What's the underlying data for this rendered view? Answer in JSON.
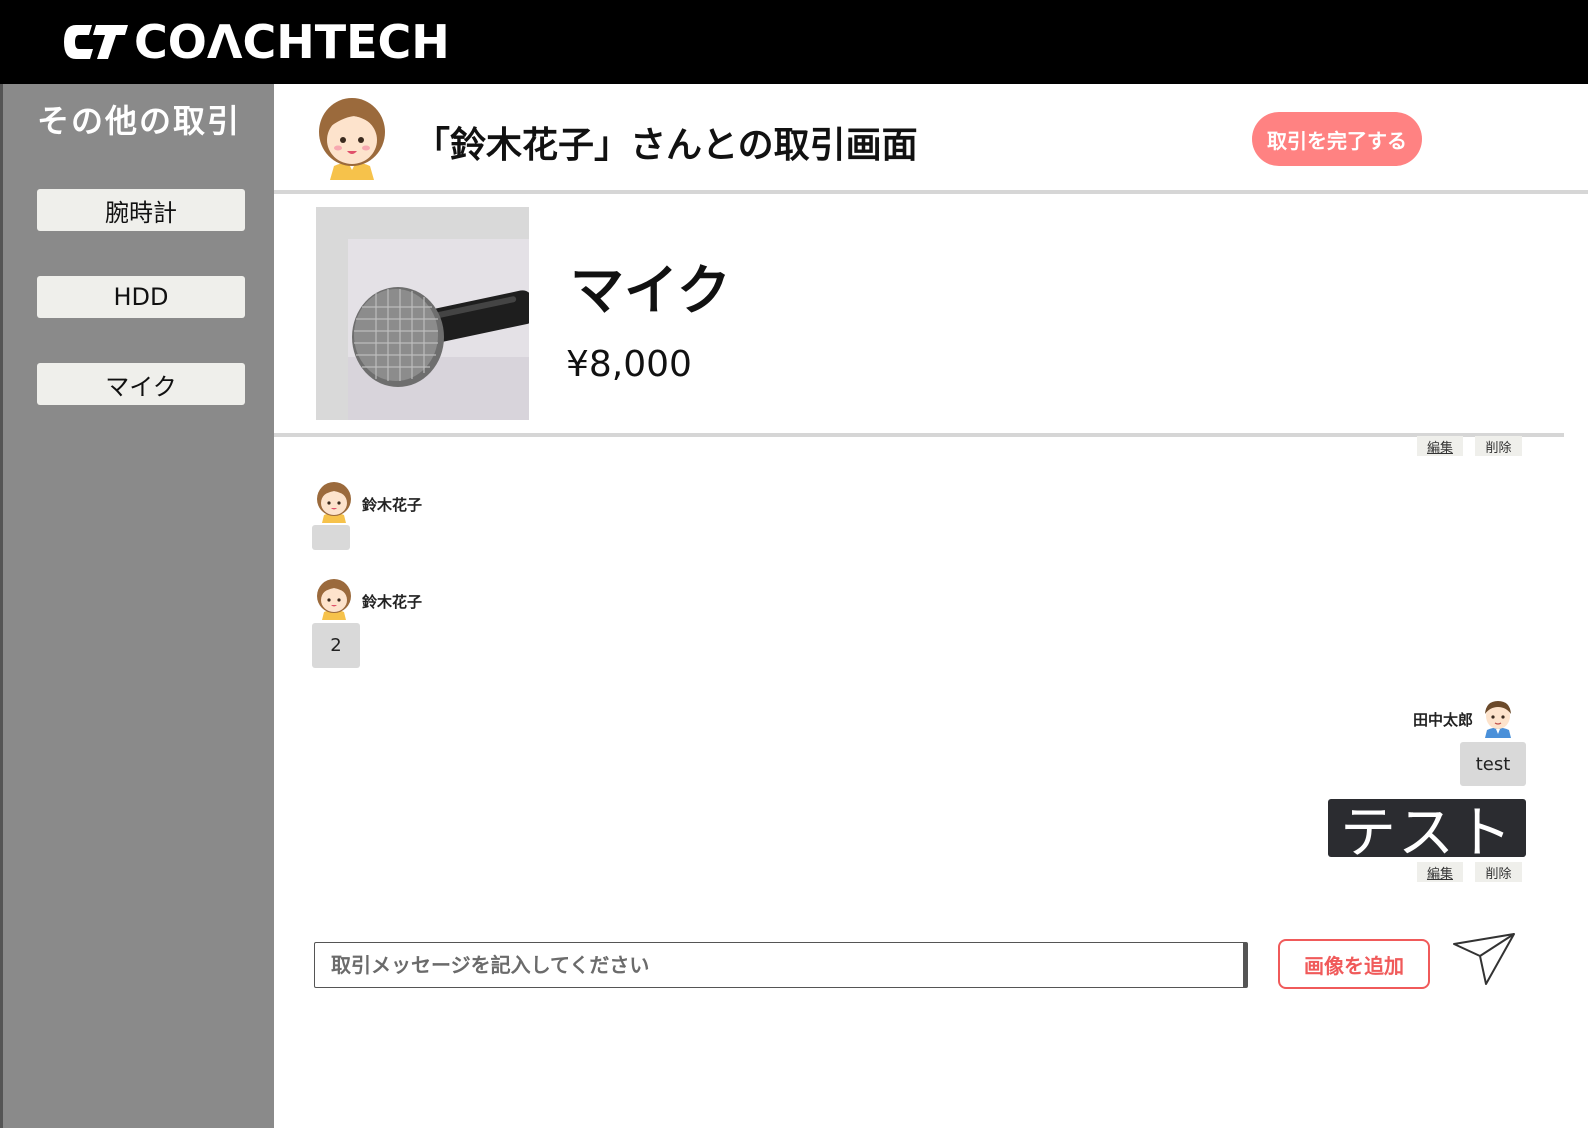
{
  "header": {
    "logo_text": "COΛCHTECH"
  },
  "sidebar": {
    "title": "その他の取引",
    "items": [
      {
        "label": "腕時計"
      },
      {
        "label": "HDD"
      },
      {
        "label": "マイク"
      }
    ]
  },
  "main": {
    "title": "「鈴木花子」さんとの取引画面",
    "complete_button": "取引を完了する"
  },
  "product": {
    "name": "マイク",
    "price": "¥8,000"
  },
  "chat": {
    "edit_label": "編集",
    "delete_label": "削除",
    "messages": [
      {
        "sender": "鈴木花子",
        "text": ""
      },
      {
        "sender": "鈴木花子",
        "text": "2"
      },
      {
        "sender": "田中太郎",
        "text": "test",
        "image_text": "テスト"
      }
    ]
  },
  "composer": {
    "placeholder": "取引メッセージを記入してください",
    "add_image_button": "画像を追加"
  },
  "colors": {
    "header_bg": "#000000",
    "sidebar_bg": "#8a8a8a",
    "accent_pink": "#ff8282",
    "accent_red": "#f05a5a",
    "bubble_bg": "#d9d9d9"
  },
  "icons": {
    "logo": "coachtech-logo-icon",
    "send": "send-paper-plane-icon",
    "partner_avatar": "woman-avatar-icon",
    "self_avatar": "man-avatar-icon"
  }
}
